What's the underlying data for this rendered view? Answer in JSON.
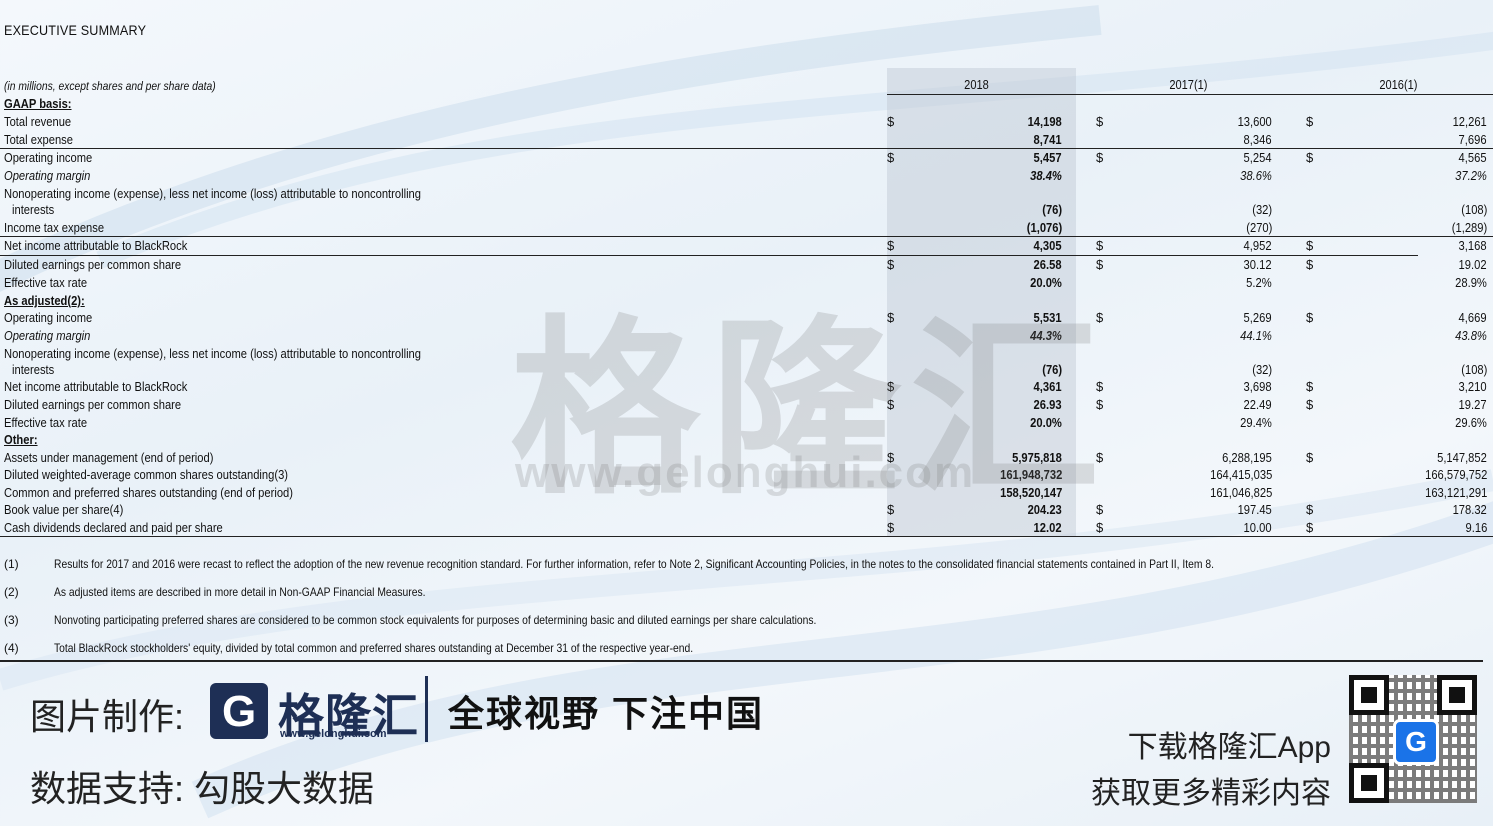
{
  "title": "EXECUTIVE SUMMARY",
  "note": "(in millions, except shares and per share data)",
  "years": [
    "2018",
    "2017(1)",
    "2016(1)"
  ],
  "rows": [
    {
      "label": "GAAP basis:",
      "type": "section-bold"
    },
    {
      "label": "Total revenue",
      "dollar": true,
      "values": [
        "14,198",
        "13,600",
        "12,261"
      ]
    },
    {
      "label": "Total expense",
      "values": [
        "8,741",
        "8,346",
        "7,696"
      ]
    },
    {
      "label": "Operating income",
      "dollar": true,
      "values": [
        "5,457",
        "5,254",
        "4,565"
      ]
    },
    {
      "label": "Operating margin",
      "italic": true,
      "values": [
        "38.4%",
        "38.6%",
        "37.2%"
      ]
    },
    {
      "label": "Nonoperating income (expense), less net income (loss) attributable to noncontrolling",
      "values": [
        "",
        "",
        ""
      ]
    },
    {
      "label": "  interests",
      "values": [
        "(76)",
        "(32)",
        "(108)"
      ]
    },
    {
      "label": "Income tax expense",
      "values": [
        "(1,076)",
        "(270)",
        "(1,289)"
      ]
    },
    {
      "label": "Net income attributable to BlackRock",
      "dollar": true,
      "values": [
        "4,305",
        "4,952",
        "3,168"
      ]
    },
    {
      "label": "Diluted earnings per common share",
      "dollar": true,
      "values": [
        "26.58",
        "30.12",
        "19.02"
      ]
    },
    {
      "label": "Effective tax rate",
      "values": [
        "20.0%",
        "5.2%",
        "28.9%"
      ]
    },
    {
      "label": "As adjusted(2):",
      "type": "section"
    },
    {
      "label": "Operating income",
      "dollar": true,
      "values": [
        "5,531",
        "5,269",
        "4,669"
      ]
    },
    {
      "label": "Operating margin",
      "italic": true,
      "values": [
        "44.3%",
        "44.1%",
        "43.8%"
      ]
    },
    {
      "label": "Nonoperating income (expense), less net income (loss) attributable to noncontrolling",
      "values": [
        "",
        "",
        ""
      ]
    },
    {
      "label": "  interests",
      "values": [
        "(76)",
        "(32)",
        "(108)"
      ]
    },
    {
      "label": "Net income attributable to BlackRock",
      "dollar": true,
      "values": [
        "4,361",
        "3,698",
        "3,210"
      ]
    },
    {
      "label": "Diluted earnings per common share",
      "dollar": true,
      "values": [
        "26.93",
        "22.49",
        "19.27"
      ]
    },
    {
      "label": "Effective tax rate",
      "values": [
        "20.0%",
        "29.4%",
        "29.6%"
      ]
    },
    {
      "label": "Other:",
      "type": "section"
    },
    {
      "label": "Assets under management (end of period)",
      "dollar": true,
      "values": [
        "5,975,818",
        "6,288,195",
        "5,147,852"
      ]
    },
    {
      "label": "Diluted weighted-average common shares outstanding(3)",
      "values": [
        "161,948,732",
        "164,415,035",
        "166,579,752"
      ]
    },
    {
      "label": "Common and preferred shares outstanding (end of period)",
      "values": [
        "158,520,147",
        "161,046,825",
        "163,121,291"
      ]
    },
    {
      "label": "Book value per share(4)",
      "dollar": true,
      "values": [
        "204.23",
        "197.45",
        "178.32"
      ]
    },
    {
      "label": "Cash dividends declared and paid per share",
      "dollar": true,
      "values": [
        "12.02",
        "10.00",
        "9.16"
      ]
    }
  ],
  "footnotes": [
    {
      "n": "(1)",
      "text": "Results for 2017 and 2016 were recast to reflect the adoption of the new revenue recognition standard. For further information, refer to Note 2, Significant Accounting Policies, in the notes to the consolidated financial statements contained in Part II, Item 8."
    },
    {
      "n": "(2)",
      "text": "As adjusted items are described in more detail in Non-GAAP Financial Measures."
    },
    {
      "n": "(3)",
      "text": "Nonvoting participating preferred shares are considered to be common stock equivalents for purposes of determining basic and diluted earnings per share calculations."
    },
    {
      "n": "(4)",
      "text": "Total BlackRock stockholders' equity, divided by total common and preferred shares outstanding at December 31 of the respective year-end."
    }
  ],
  "watermark": {
    "main": "格隆汇",
    "url": "www.gelonghui.com"
  },
  "banner": {
    "made_by": "图片制作:",
    "logo_letter": "G",
    "logo_name": "格隆汇",
    "logo_url": "www.gelonghui.com",
    "slogan": "全球视野 下注中国",
    "data_support": "数据支持:  勾股大数据",
    "download": "下载格隆汇App",
    "more": "获取更多精彩内容",
    "qr_letter": "G"
  }
}
